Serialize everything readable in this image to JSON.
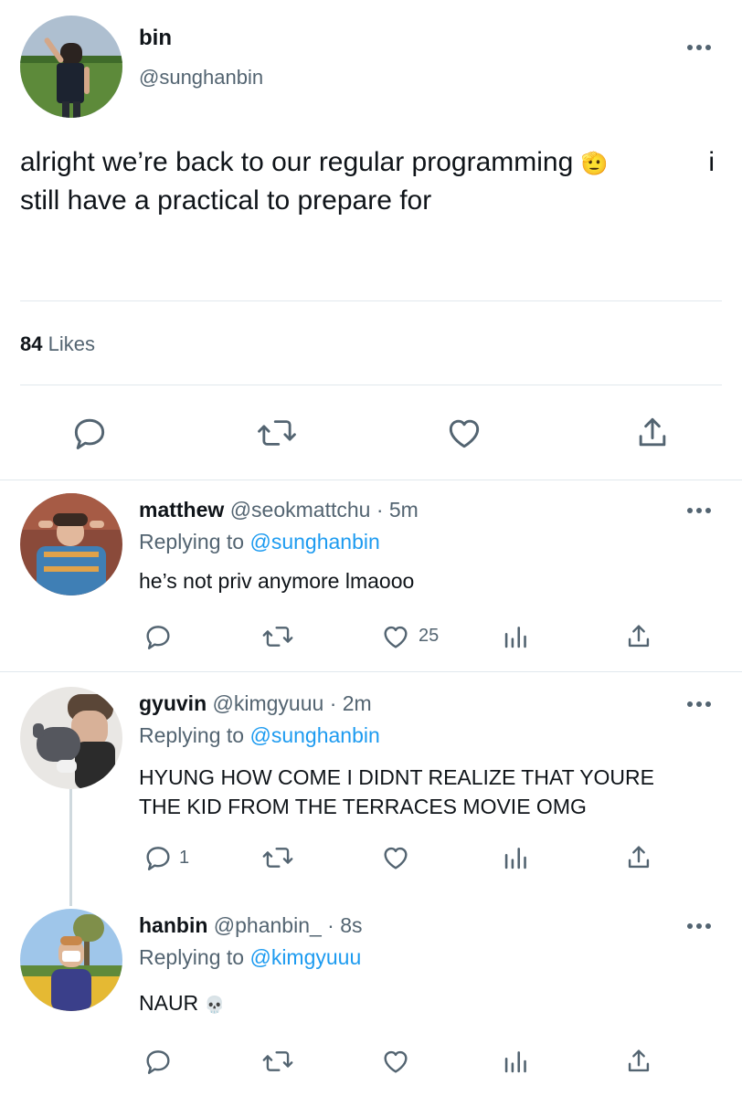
{
  "main_tweet": {
    "display_name": "bin",
    "handle": "@sunghanbin",
    "text_line1": "alright we’re back to our regular programming",
    "emoji": "🫡",
    "text_line1_end": "i",
    "text_line2": "still have a practical to prepare for",
    "likes_count": "84",
    "likes_label": "Likes"
  },
  "replies": [
    {
      "display_name": "matthew",
      "handle_time": "@seokmattchu · 5m",
      "replying_label": "Replying to",
      "replying_to": "@sunghanbin",
      "text": "he’s not priv anymore lmaooo",
      "like_count": "25",
      "reply_count": ""
    },
    {
      "display_name": "gyuvin",
      "handle_time": "@kimgyuuu · 2m",
      "replying_label": "Replying to",
      "replying_to": "@sunghanbin",
      "text_line1": "HYUNG HOW COME I DIDNT REALIZE THAT YOURE",
      "text_line2": "THE KID FROM THE TERRACES MOVIE OMG",
      "reply_count": "1",
      "like_count": ""
    },
    {
      "display_name": "hanbin",
      "handle_time": "@phanbin_ · 8s",
      "replying_label": "Replying to",
      "replying_to": "@kimgyuuu",
      "text": "NAUR",
      "emoji": "💀",
      "reply_count": "",
      "like_count": ""
    }
  ],
  "icons": {
    "reply": "reply-icon",
    "retweet": "retweet-icon",
    "like": "heart-icon",
    "analytics": "analytics-icon",
    "share": "share-icon",
    "more": "more-icon"
  },
  "colors": {
    "text": "#0f1419",
    "muted": "#536471",
    "link": "#1d9bf0",
    "divider": "#e1e8ed"
  }
}
